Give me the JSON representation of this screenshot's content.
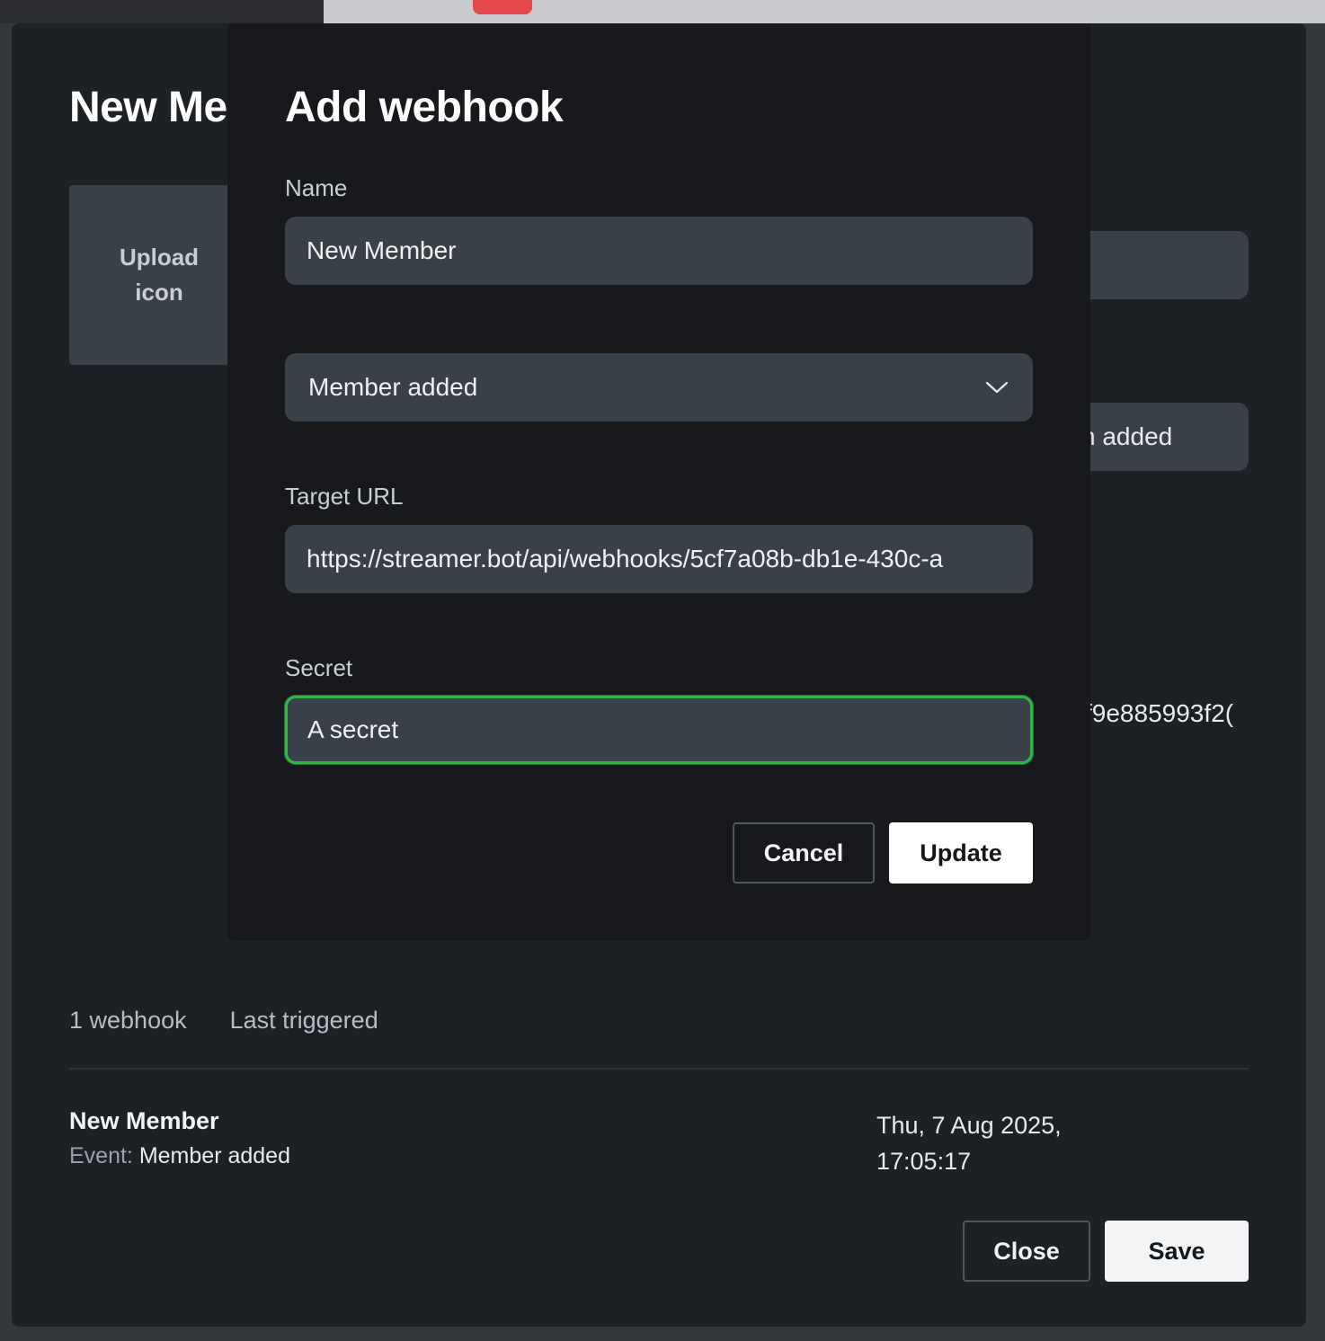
{
  "outer_modal": {
    "title": "New Me",
    "upload_icon_label": "Upload icon",
    "event_field_partial": "n added",
    "secret_partial": "f9e885993f2(",
    "tabs": [
      "1 webhook",
      "Last triggered"
    ],
    "webhook_row": {
      "name": "New Member",
      "event_label": "Event:",
      "event_value": "Member added",
      "last_triggered": "Thu, 7 Aug 2025, 17:05:17"
    },
    "close_label": "Close",
    "save_label": "Save"
  },
  "inner_modal": {
    "title": "Add webhook",
    "name_label": "Name",
    "name_value": "New Member",
    "event_value": "Member added",
    "url_label": "Target URL",
    "url_value": "https://streamer.bot/api/webhooks/5cf7a08b-db1e-430c-a",
    "secret_label": "Secret",
    "secret_value": "A secret",
    "cancel_label": "Cancel",
    "update_label": "Update"
  },
  "colors": {
    "focus_ring": "#2fb34a",
    "accent_red": "#e5484d"
  },
  "icons": {
    "select_chevron": "chevron-down-icon"
  }
}
